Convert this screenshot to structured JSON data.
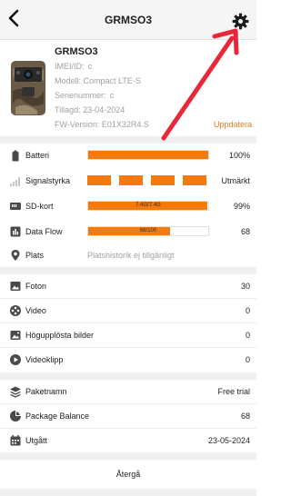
{
  "header": {
    "title": "GRMSO3"
  },
  "device": {
    "name": "GRMSO3",
    "imei": "IMEI/ID:  с",
    "model": "Modell: Compact LTE-S",
    "serial": "Serienummer:  с",
    "added": "Tillagd: 23-04-2024",
    "firmware": "FW-Version: E01X32R4.S",
    "update_label": "Uppdatera"
  },
  "status": {
    "battery": {
      "label": "Batteri",
      "value": "100%",
      "level": 1.0
    },
    "signal": {
      "label": "Signalstyrka",
      "value": "Utmärkt",
      "bars_filled": 4,
      "bars_total": 4
    },
    "sd": {
      "label": "SD-kort",
      "bar_text": "7.4G/7.4G",
      "value": "99%",
      "level": 0.99
    },
    "dataflow": {
      "label": "Data Flow",
      "bar_text": "68/100",
      "value": "68",
      "level": 0.68
    },
    "location": {
      "label": "Plats",
      "value": "Platshistorik ej tillgänligt"
    }
  },
  "media": [
    {
      "label": "Foton",
      "value": "30"
    },
    {
      "label": "Video",
      "value": "0"
    },
    {
      "label": "Högupplösta bilder",
      "value": "0"
    },
    {
      "label": "Videoklipp",
      "value": "0"
    }
  ],
  "package": [
    {
      "label": "Paketnamn",
      "value": "Free trial"
    },
    {
      "label": "Package Balance",
      "value": "68"
    },
    {
      "label": "Utgått",
      "value": "23-05-2024"
    }
  ],
  "footer": {
    "back_label": "Återgå"
  },
  "colors": {
    "accent": "#f57a0c",
    "update_link": "#e97b1b",
    "annotation_arrow": "#e8283a"
  }
}
